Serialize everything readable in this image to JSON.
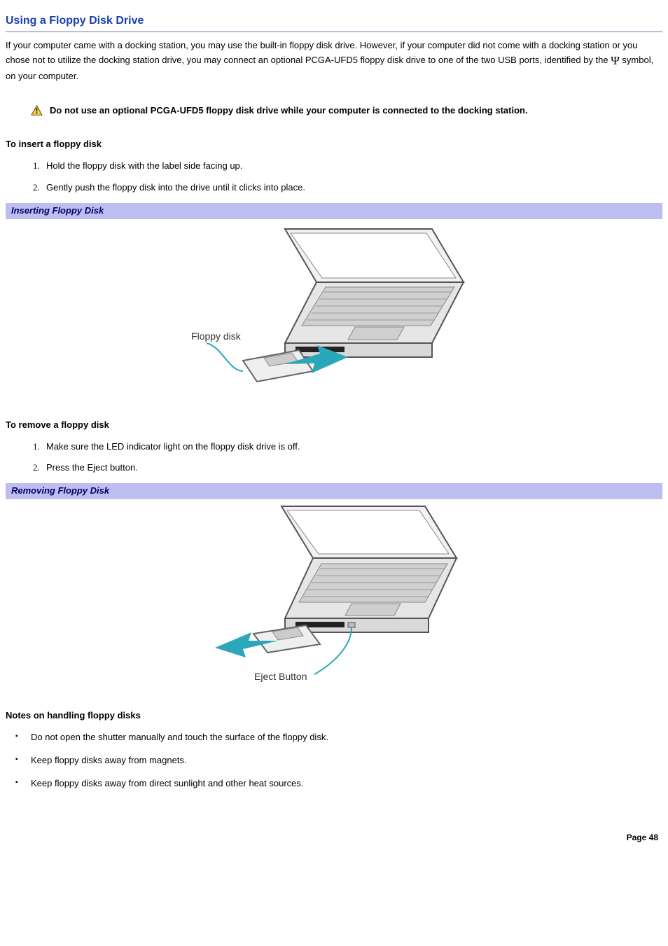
{
  "title": "Using a Floppy Disk Drive",
  "intro_part1": "If your computer came with a docking station, you may use the built-in floppy disk drive. However, if your computer did not come with a docking station or you chose not to utilize the docking station drive, you may connect an optional PCGA-UFD5 floppy disk drive to one of the two USB ports, identified by the ",
  "intro_part2": "symbol, on your computer.",
  "usb_symbol": "Ψ",
  "warning_text": "Do not use an optional PCGA-UFD5 floppy disk drive while your computer is connected to the docking station.",
  "insert_heading": "To insert a floppy disk",
  "insert_steps": [
    "Hold the floppy disk with the label side facing up.",
    "Gently push the floppy disk into the drive until it clicks into place."
  ],
  "caption_insert": "Inserting Floppy Disk",
  "fig1_label": "Floppy disk",
  "remove_heading": "To remove a floppy disk",
  "remove_steps": [
    "Make sure the LED indicator light on the floppy disk drive is off.",
    "Press the Eject button."
  ],
  "caption_remove": "Removing Floppy Disk",
  "fig2_label": "Eject Button",
  "notes_heading": "Notes on handling floppy disks",
  "notes": [
    "Do not open the shutter manually and touch the surface of the floppy disk.",
    "Keep floppy disks away from magnets.",
    "Keep floppy disks away from direct sunlight and other heat sources."
  ],
  "page_footer": "Page 48"
}
